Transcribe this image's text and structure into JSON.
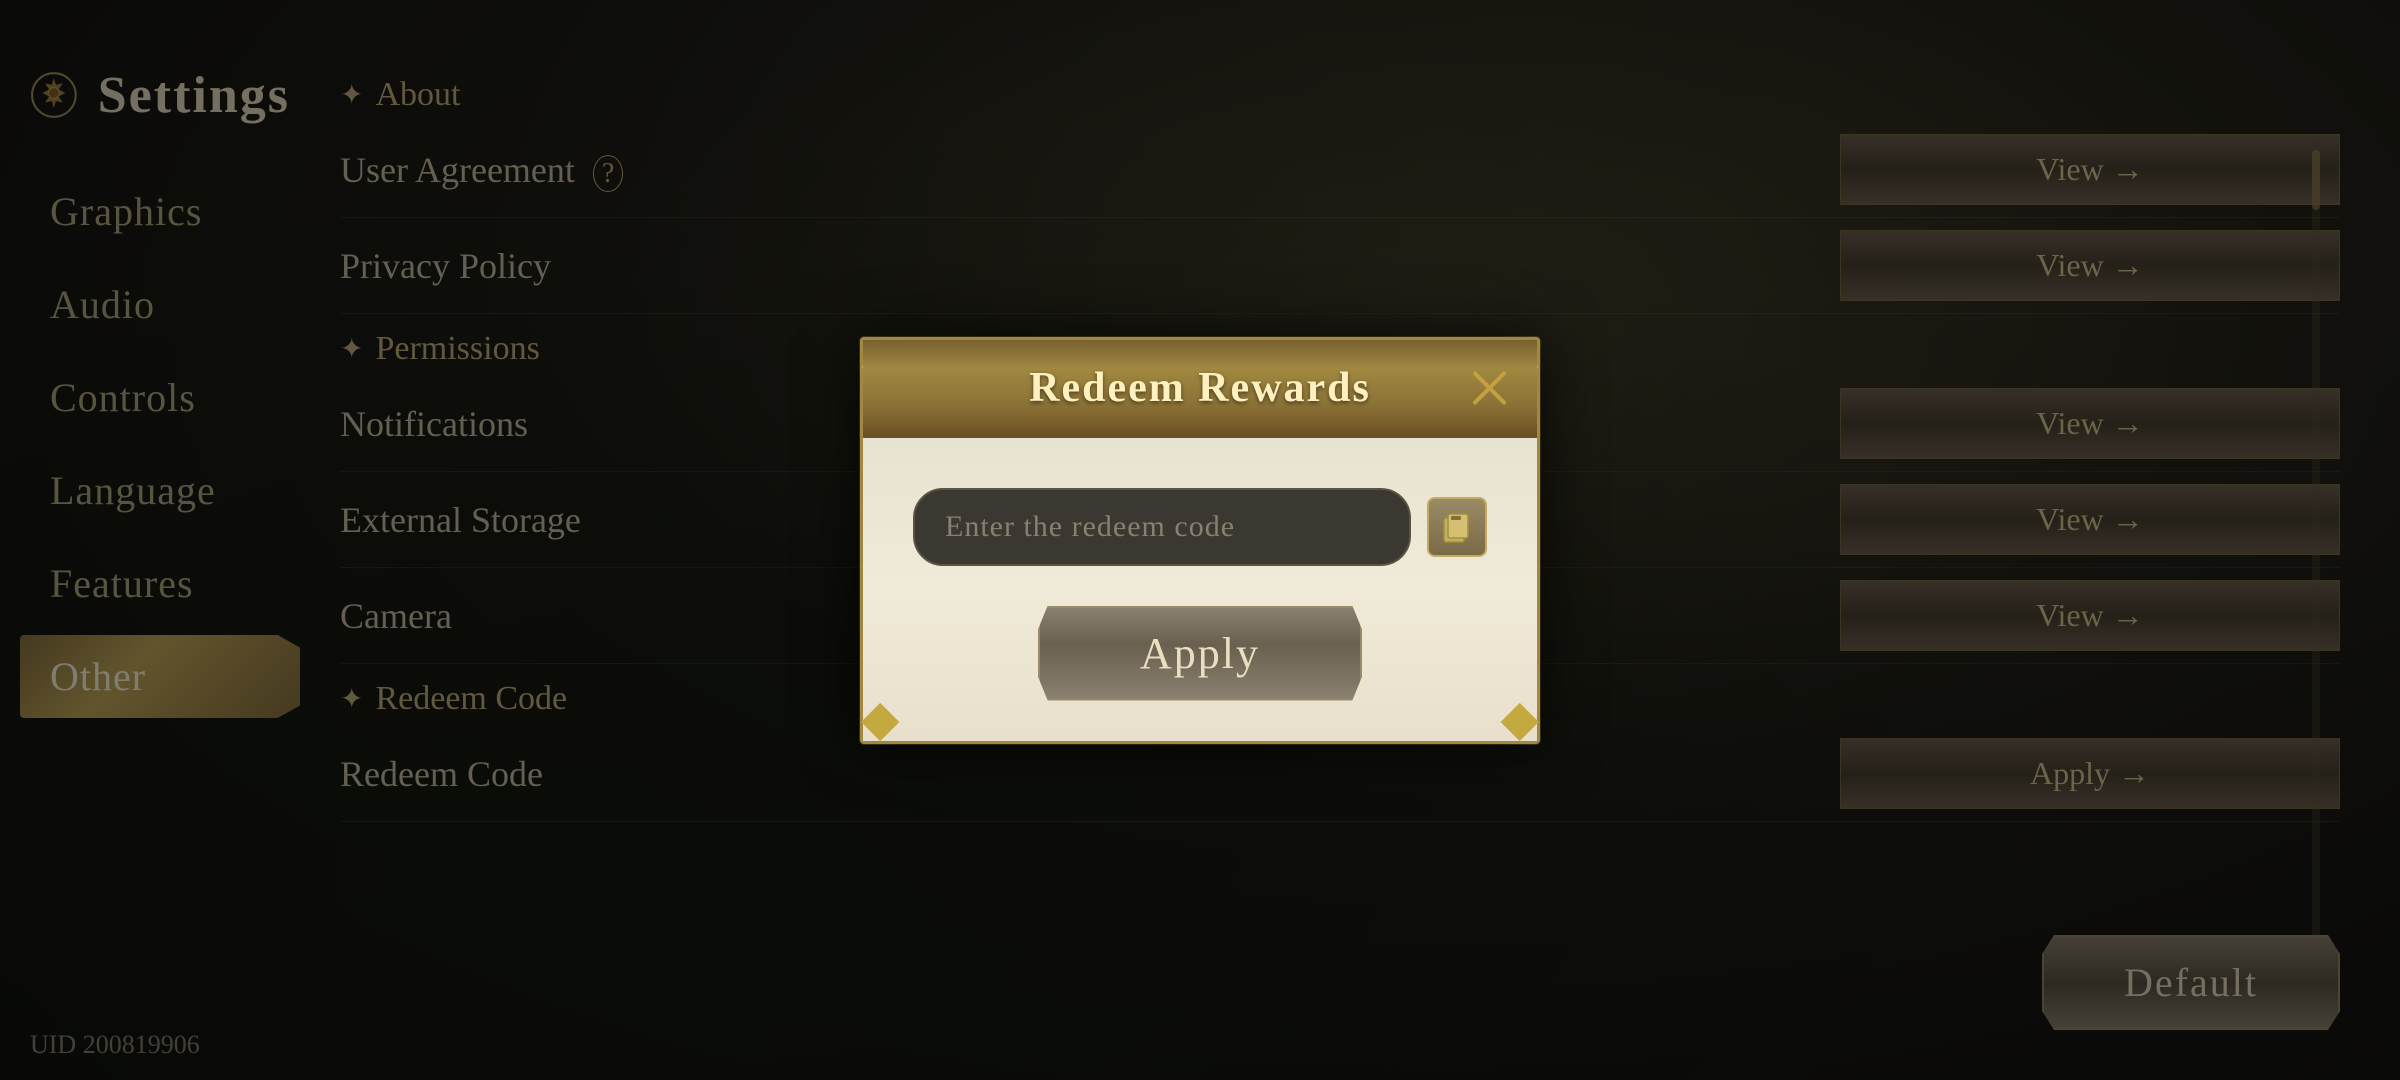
{
  "app": {
    "title": "Settings",
    "uid": "UID 200819906"
  },
  "sidebar": {
    "items": [
      {
        "id": "graphics",
        "label": "Graphics",
        "active": false
      },
      {
        "id": "audio",
        "label": "Audio",
        "active": false
      },
      {
        "id": "controls",
        "label": "Controls",
        "active": false
      },
      {
        "id": "language",
        "label": "Language",
        "active": false
      },
      {
        "id": "features",
        "label": "Features",
        "active": false
      },
      {
        "id": "other",
        "label": "Other",
        "active": true
      }
    ]
  },
  "main": {
    "sections": [
      {
        "type": "header",
        "label": "About"
      },
      {
        "type": "row",
        "label": "User Agreement",
        "badge": "?",
        "action": "View →"
      },
      {
        "type": "row",
        "label": "Privacy Policy",
        "action": "View →"
      },
      {
        "type": "header",
        "label": "Permissions"
      },
      {
        "type": "row",
        "label": "Notifications",
        "action": "View →"
      },
      {
        "type": "row",
        "label": "External Storage",
        "action": "View →"
      },
      {
        "type": "row",
        "label": "Camera",
        "action": "View →"
      },
      {
        "type": "header",
        "label": "Redeem Code"
      },
      {
        "type": "row",
        "label": "Redeem Code",
        "action": "Apply →"
      }
    ],
    "default_button": "Default"
  },
  "modal": {
    "title": "Redeem Rewards",
    "close_symbol": "✕",
    "input_placeholder": "Enter the redeem code",
    "apply_label": "Apply",
    "paste_icon": "📋"
  }
}
